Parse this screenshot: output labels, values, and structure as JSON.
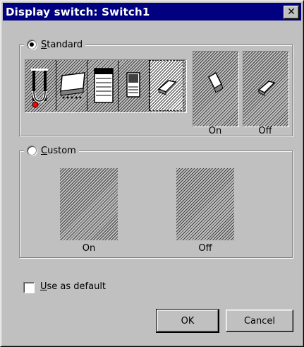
{
  "window": {
    "title": "Display switch: Switch1",
    "close_glyph": "✕"
  },
  "standard": {
    "label_first": "S",
    "label_rest": "tandard",
    "selected": true,
    "icons": [
      {
        "name": "knife-switch-icon"
      },
      {
        "name": "rocker-panel-icon"
      },
      {
        "name": "stacked-panel-icon"
      },
      {
        "name": "small-panel-icon"
      },
      {
        "name": "toggle-switch-icon",
        "selected": true
      }
    ],
    "on_label": "On",
    "off_label": "Off"
  },
  "custom": {
    "label_first": "C",
    "label_rest": "ustom",
    "selected": false,
    "on_label": "On",
    "off_label": "Off"
  },
  "use_as_default": {
    "label_first": "U",
    "label_rest": "se as default",
    "checked": false
  },
  "buttons": {
    "ok": "OK",
    "cancel": "Cancel"
  },
  "colors": {
    "title_bar": "#000080",
    "face": "#c0c0c0",
    "accent_red": "#ff0000"
  }
}
